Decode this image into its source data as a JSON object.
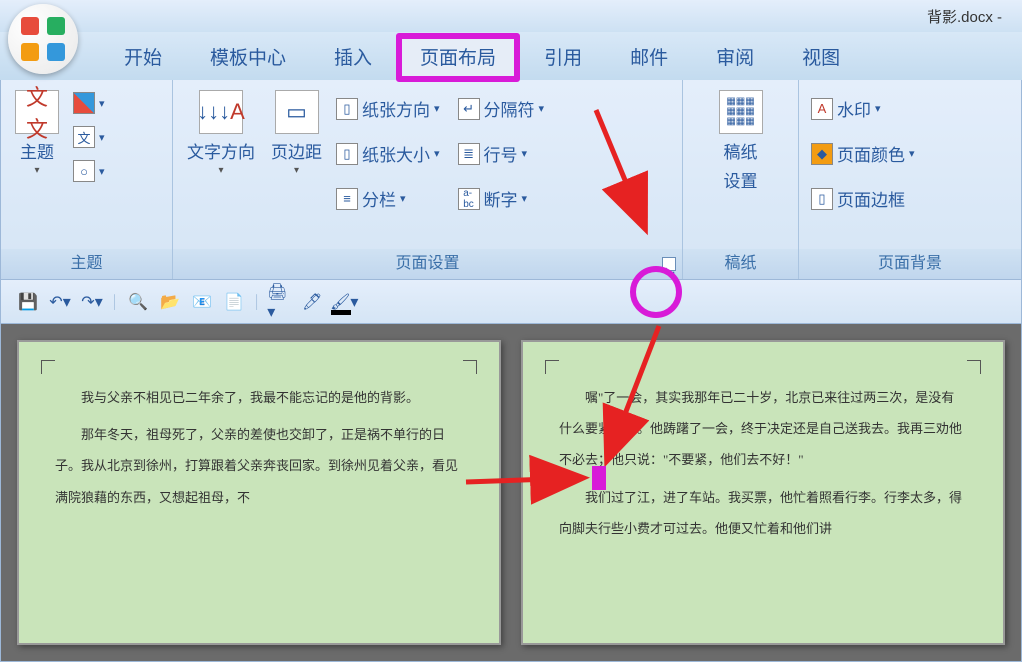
{
  "title": "背影.docx - ",
  "tabs": [
    "开始",
    "模板中心",
    "插入",
    "页面布局",
    "引用",
    "邮件",
    "审阅",
    "视图"
  ],
  "activeTabIndex": 3,
  "ribbon": {
    "groups": [
      {
        "label": "主题",
        "items": {
          "theme": "主题"
        }
      },
      {
        "label": "页面设置",
        "items": {
          "text_dir": "文字方向",
          "margins": "页边距",
          "orientation": "纸张方向",
          "size": "纸张大小",
          "columns": "分栏",
          "breaks": "分隔符",
          "line_nums": "行号",
          "hyphen": "断字"
        }
      },
      {
        "label": "稿纸",
        "items": {
          "manuscript": "稿纸",
          "settings": "设置"
        }
      },
      {
        "label": "页面背景",
        "items": {
          "watermark": "水印",
          "page_color": "页面颜色",
          "page_border": "页面边框"
        }
      }
    ]
  },
  "doc": {
    "page1": [
      "我与父亲不相见已二年余了，我最不能忘记的是他的背影。",
      "那年冬天，祖母死了，父亲的差使也交卸了，正是祸不单行的日子。我从北京到徐州，打算跟着父亲奔丧回家。到徐州见着父亲，看见满院狼藉的东西，又想起祖母，不"
    ],
    "page2": [
      "嘱\"了一会，其实我那年已二十岁，北京已来往过两三次，是没有什么要紧的了。他踌躇了一会，终于决定还是自己送我去。我再三劝他不必去；他只说：\"不要紧，他们去不好！\"",
      "我们过了江，进了车站。我买票，他忙着照看行李。行李太多，得向脚夫行些小费才可过去。他便又忙着和他们讲"
    ]
  }
}
